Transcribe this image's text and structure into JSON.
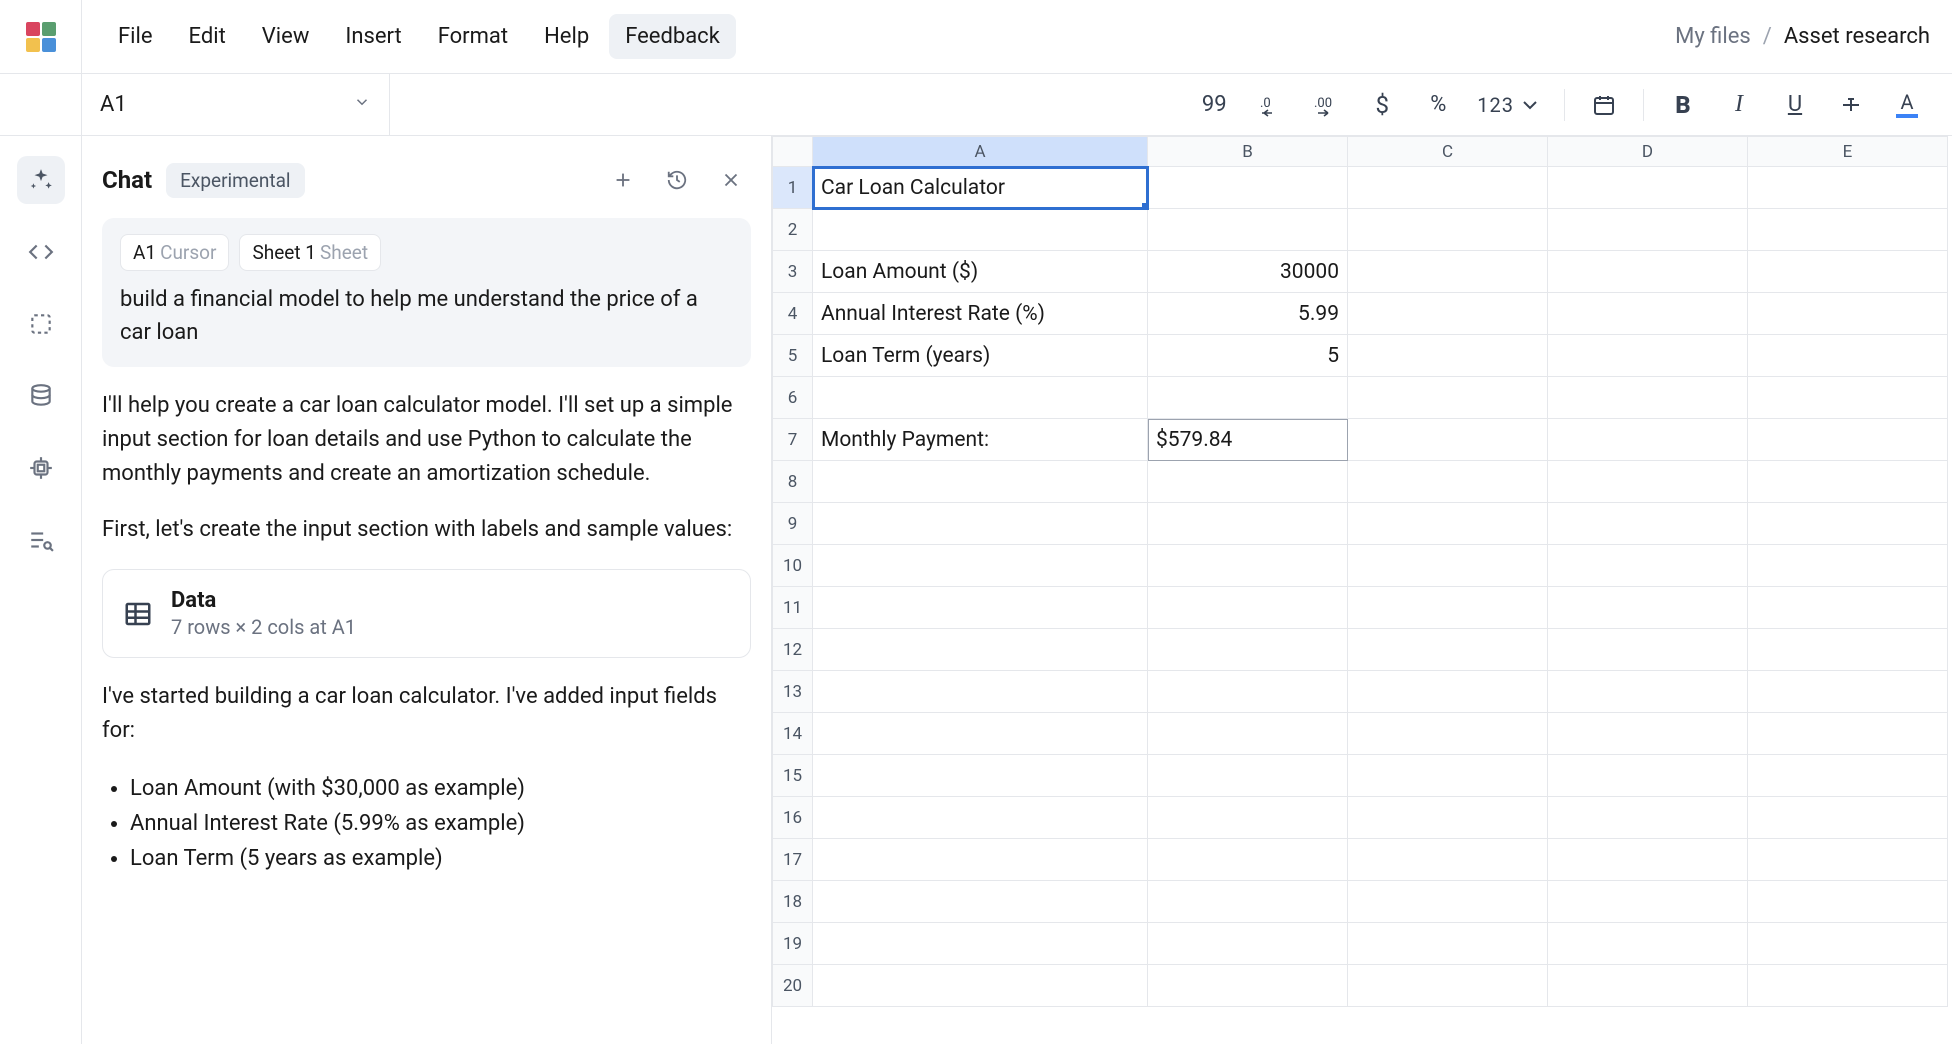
{
  "menu": {
    "items": [
      "File",
      "Edit",
      "View",
      "Insert",
      "Format",
      "Help",
      "Feedback"
    ],
    "active_index": 6
  },
  "breadcrumb": {
    "root": "My files",
    "sep": "/",
    "current": "Asset research"
  },
  "cell_ref": "A1",
  "toolbar": {
    "num_literal": "99",
    "format123": "123"
  },
  "chat": {
    "title": "Chat",
    "badge": "Experimental",
    "chips": {
      "cursor_ref": "A1",
      "cursor_label": "Cursor",
      "sheet_ref": "Sheet 1",
      "sheet_label": "Sheet"
    },
    "user_msg": "build a financial model to help me understand the price of a car loan",
    "assist_p1": "I'll help you create a car loan calculator model. I'll set up a simple input section for loan details and use Python to calculate the monthly payments and create an amortization schedule.",
    "assist_p2": "First, let's create the input section with labels and sample values:",
    "data_card": {
      "title": "Data",
      "sub": "7 rows × 2 cols at A1"
    },
    "assist_p3": "I've started building a car loan calculator. I've added input fields for:",
    "bullets": [
      "Loan Amount (with $30,000 as example)",
      "Annual Interest Rate (5.99% as example)",
      "Loan Term (5 years as example)"
    ]
  },
  "sheet": {
    "columns": [
      "A",
      "B",
      "C",
      "D",
      "E"
    ],
    "rows": 20,
    "selected": {
      "row": 1,
      "col": "A"
    },
    "highlight": {
      "row": 7,
      "col": "B"
    },
    "cells": {
      "A1": "Car Loan Calculator",
      "A3": "Loan Amount ($)",
      "B3": "30000",
      "A4": "Annual Interest Rate (%)",
      "B4": "5.99",
      "A5": "Loan Term (years)",
      "B5": "5",
      "A7": "Monthly Payment:",
      "B7": "$579.84"
    }
  },
  "chart_data": {
    "type": "table",
    "title": "Car Loan Calculator",
    "rows": [
      {
        "label": "Loan Amount ($)",
        "value": 30000
      },
      {
        "label": "Annual Interest Rate (%)",
        "value": 5.99
      },
      {
        "label": "Loan Term (years)",
        "value": 5
      },
      {
        "label": "Monthly Payment:",
        "value": "$579.84"
      }
    ]
  }
}
